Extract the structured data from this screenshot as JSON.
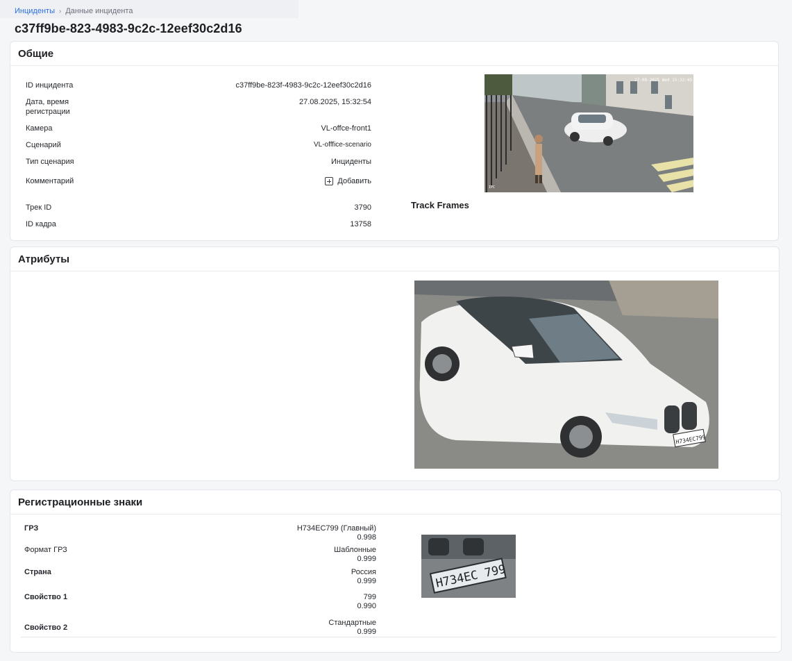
{
  "breadcrumb": {
    "parent": "Инциденты",
    "separator": "›",
    "current": "Данные инцидента"
  },
  "page_title": "c37ff9be-823-4983-9c2c-12eef30c2d16",
  "general": {
    "title": "Общие",
    "rows": [
      {
        "label": "ID инцидента",
        "value": "c37ff9be-823f-4983-9c2c-12eef30c2d16"
      },
      {
        "label": "Дата, время регистрации",
        "value": "27.08.2025, 15:32:54"
      },
      {
        "label": "Камера",
        "value": "VL-offce-front1"
      },
      {
        "label": "Сценарий",
        "value": "VL-offfice-scenario"
      },
      {
        "label": "Тип сценария",
        "value": "Инциденты"
      },
      {
        "label": "Комментарий",
        "value": "Добавить"
      },
      {
        "label": "Трек ID",
        "value": "3790"
      },
      {
        "label": "ID кадра",
        "value": "13758"
      }
    ],
    "track_frames_label": "Track Frames",
    "camera_overlay": "27-08-2025 Wed 15:32:45",
    "camera_brand": "IPC"
  },
  "attributes": {
    "title": "Атрибуты",
    "plate_text": "Н734ЕС799"
  },
  "plates": {
    "title": "Регистрационные знаки",
    "rows": [
      {
        "label": "ГРЗ",
        "value": "Н734ЕС799 (Главный)",
        "score": "0.998"
      },
      {
        "label": "Формат ГРЗ",
        "value": "Шаблонные",
        "score": "0.999"
      },
      {
        "label": "Страна",
        "value": "Россия",
        "score": "0.999"
      },
      {
        "label": "Свойство 1",
        "value": "799",
        "score": "0.990"
      },
      {
        "label": "Свойство 2",
        "value": "Стандартные",
        "score": "0.999"
      }
    ],
    "plate_crop_text": "Н734ЕС 799"
  },
  "colors": {
    "link": "#2b6fe0",
    "background": "#f5f6f8",
    "card": "#ffffff"
  }
}
